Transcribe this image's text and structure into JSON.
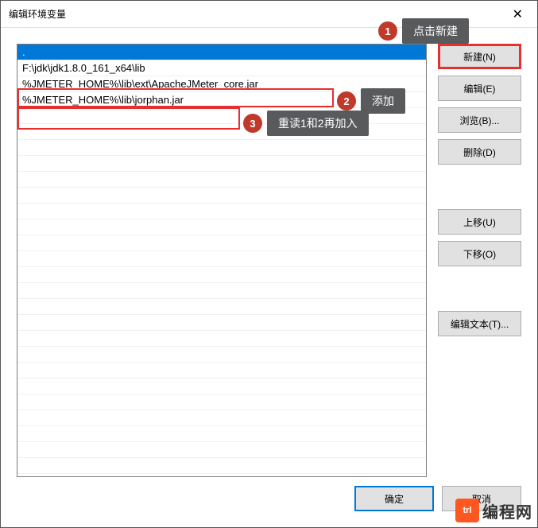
{
  "title": "编辑环境变量",
  "list": {
    "items": [
      ".",
      "F:\\jdk\\jdk1.8.0_161_x64\\lib",
      "%JMETER_HOME%\\lib\\ext\\ApacheJMeter_core.jar",
      "%JMETER_HOME%\\lib\\jorphan.jar"
    ]
  },
  "buttons": {
    "new": "新建(N)",
    "edit": "编辑(E)",
    "browse": "浏览(B)...",
    "delete": "删除(D)",
    "moveup": "上移(U)",
    "movedown": "下移(O)",
    "edittext": "编辑文本(T)...",
    "ok": "确定",
    "cancel": "取消"
  },
  "annotations": {
    "a1": {
      "num": "1",
      "text": "点击新建"
    },
    "a2": {
      "num": "2",
      "text": "添加"
    },
    "a3": {
      "num": "3",
      "text": "重读1和2再加入"
    }
  },
  "logo": {
    "icon": "trl",
    "text": "编程网"
  }
}
